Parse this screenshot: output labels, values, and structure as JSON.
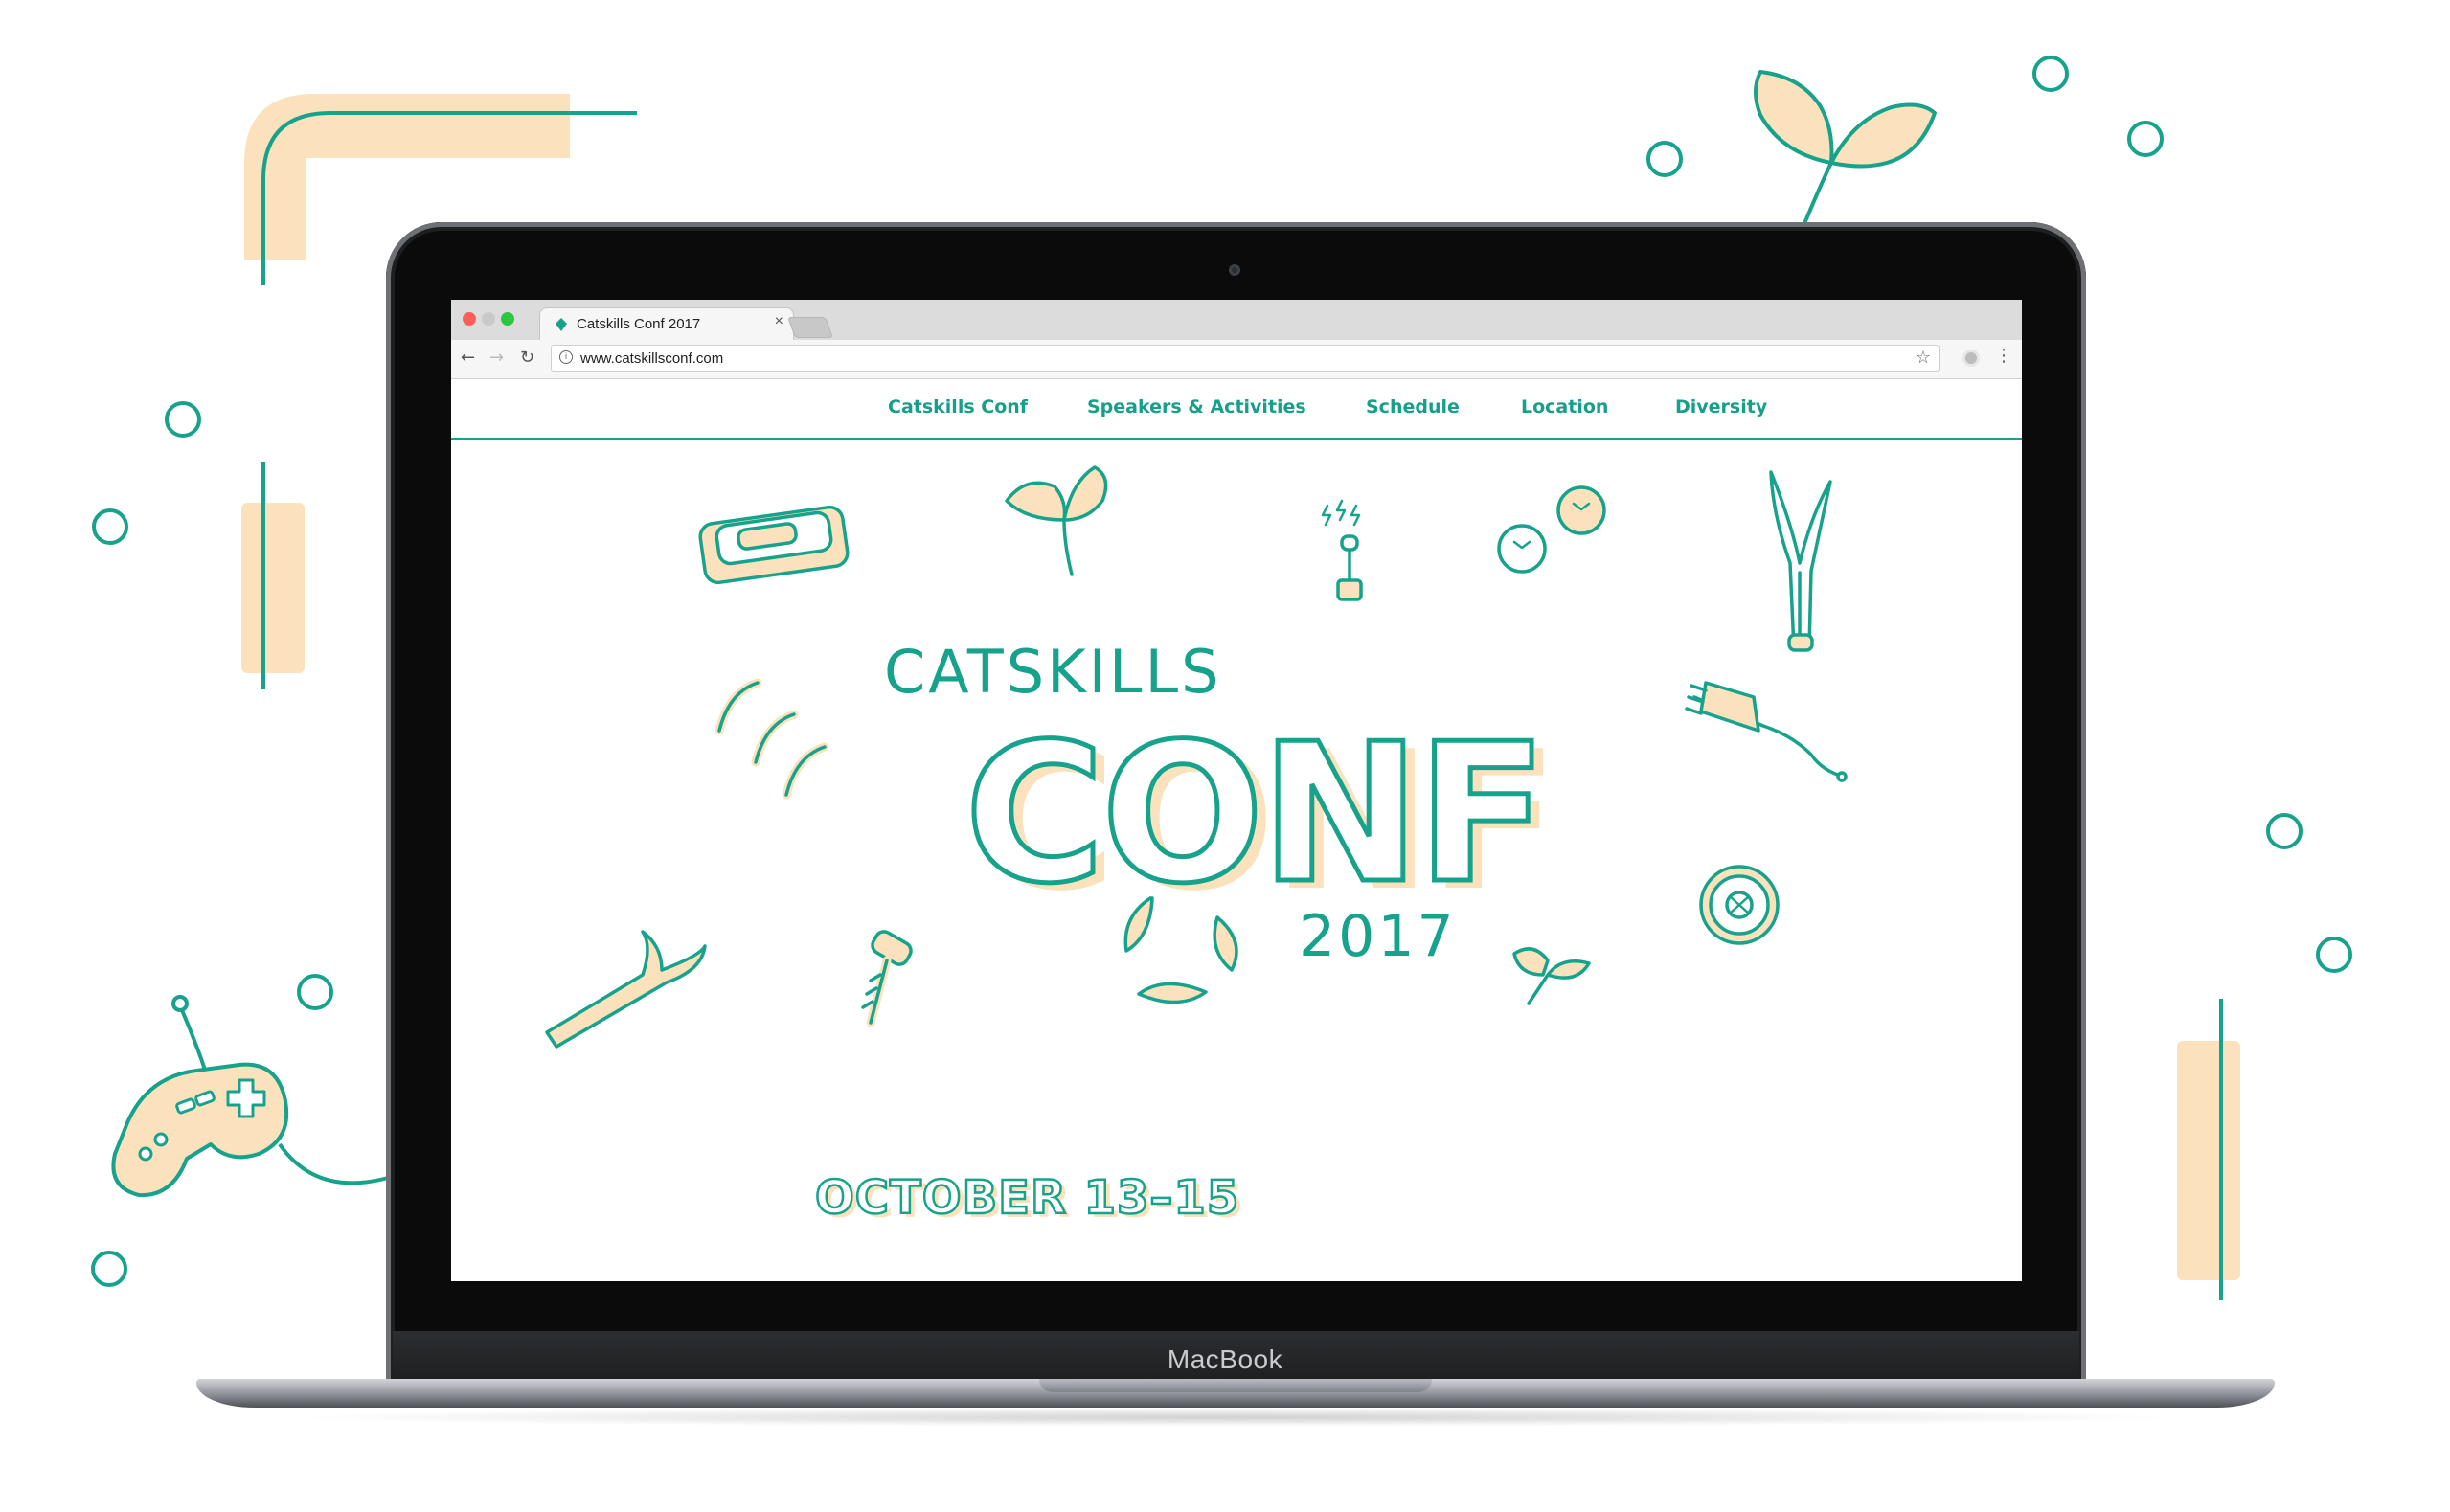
{
  "colors": {
    "accent": "#17a28c",
    "peach": "#fbe2bc",
    "window_close": "#fd5f57",
    "window_min": "#febc2e",
    "window_max": "#28c840"
  },
  "browser": {
    "tab_title": "Catskills Conf 2017",
    "tab_close": "×",
    "url": "www.catskillsconf.com",
    "back_glyph": "←",
    "forward_glyph": "→",
    "reload_glyph": "↻",
    "star_glyph": "☆",
    "menu_glyph": "⋮",
    "info_glyph": "i"
  },
  "nav": {
    "items": [
      {
        "label": "Catskills Conf"
      },
      {
        "label": "Speakers & Activities"
      },
      {
        "label": "Schedule"
      },
      {
        "label": "Location"
      },
      {
        "label": "Diversity"
      }
    ]
  },
  "hero": {
    "catskills": "CATSKILLS",
    "conf": "CONF",
    "year": "2017",
    "dates": "OCTOBER 13–15"
  },
  "device": {
    "label": "MacBook"
  },
  "icons": {
    "decor": [
      "sprout-icon",
      "game-controller-icon",
      "circle-dot",
      "bracket-line"
    ],
    "hero": [
      "harmonica-icon",
      "sprout-icon",
      "lever-switch-icon",
      "blueberries-icon",
      "leek-icon",
      "caterpillars-icon",
      "plug-icon",
      "camera-lens-icon",
      "twig-icon",
      "screw-icon",
      "leaves-icon",
      "small-sprout-icon"
    ]
  }
}
